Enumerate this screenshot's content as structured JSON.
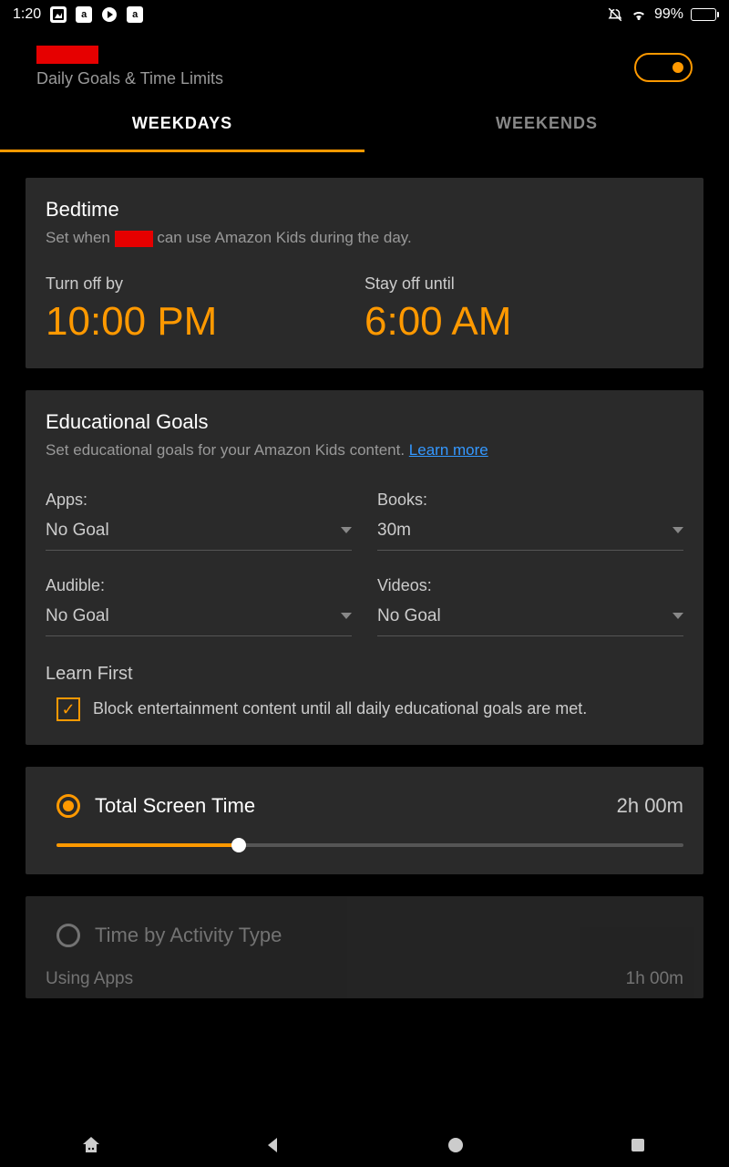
{
  "status": {
    "time": "1:20",
    "battery": "99%"
  },
  "header": {
    "subtitle": "Daily Goals & Time Limits"
  },
  "tabs": {
    "weekdays": "WEEKDAYS",
    "weekends": "WEEKENDS"
  },
  "bedtime": {
    "title": "Bedtime",
    "desc_prefix": "Set when ",
    "desc_suffix": " can use Amazon Kids during the day.",
    "off_label": "Turn off by",
    "off_time": "10:00 PM",
    "until_label": "Stay off until",
    "until_time": "6:00 AM"
  },
  "goals": {
    "title": "Educational Goals",
    "desc": "Set educational goals for your Amazon Kids content. ",
    "learn_more": "Learn more",
    "apps_label": "Apps:",
    "apps_value": "No Goal",
    "books_label": "Books:",
    "books_value": "30m",
    "audible_label": "Audible:",
    "audible_value": "No Goal",
    "videos_label": "Videos:",
    "videos_value": "No Goal",
    "learn_first_title": "Learn First",
    "learn_first_desc": "Block entertainment content until all daily educational goals are met."
  },
  "screen_time": {
    "total_label": "Total Screen Time",
    "total_value": "2h 00m",
    "activity_label": "Time by Activity Type",
    "using_apps_label": "Using Apps",
    "using_apps_value": "1h 00m"
  }
}
